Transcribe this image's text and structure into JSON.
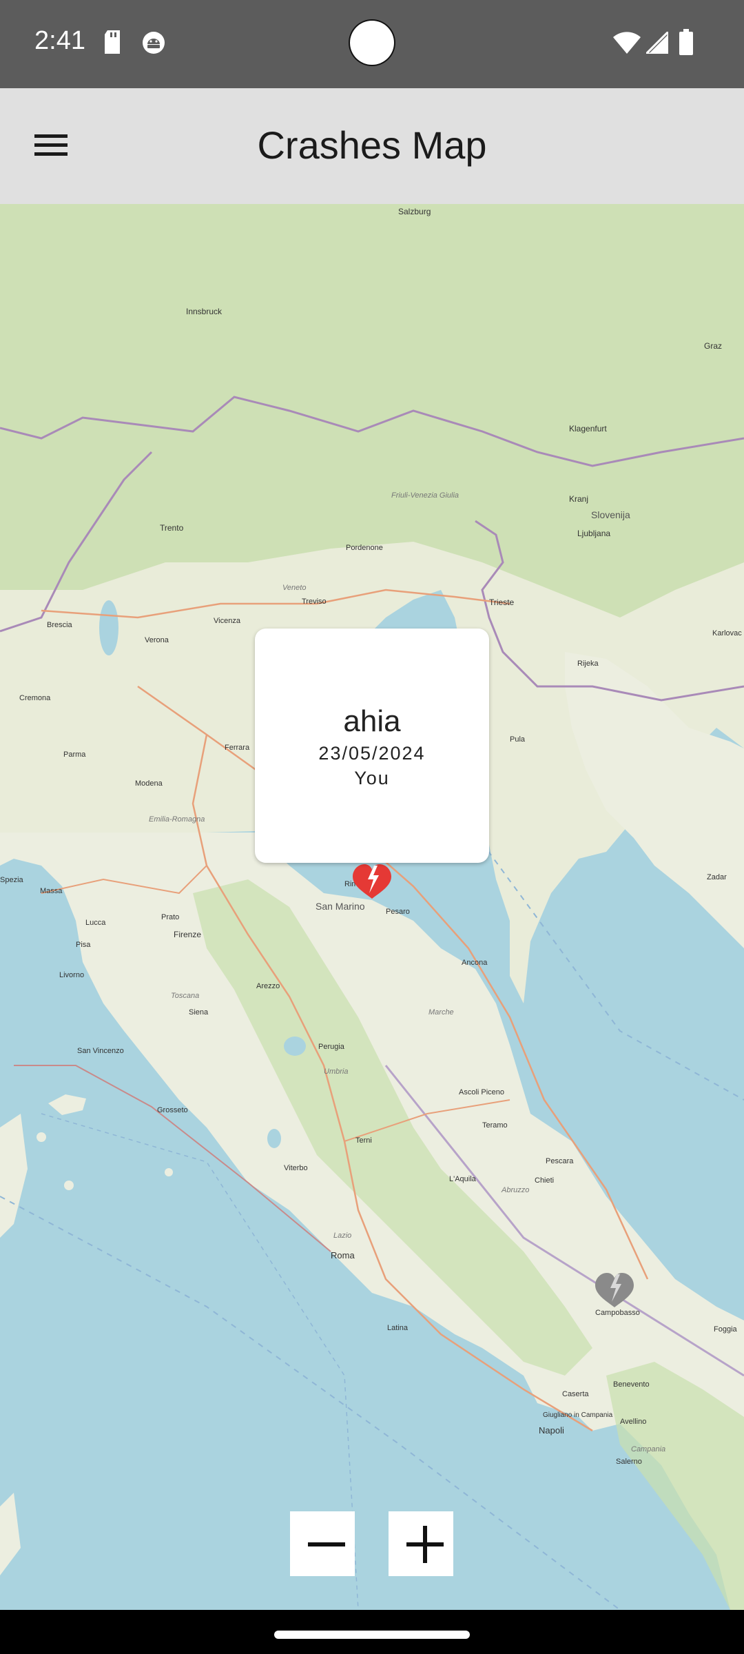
{
  "status_bar": {
    "time": "2:41",
    "left_icons": [
      "sd-card-icon",
      "android-debug-icon"
    ],
    "right_icons": [
      "wifi-icon",
      "cell-signal-icon",
      "battery-icon"
    ]
  },
  "app_bar": {
    "title": "Crashes Map",
    "menu_icon": "hamburger-menu-icon"
  },
  "map": {
    "labels": {
      "salzburg": "Salzburg",
      "innsbruck": "Innsbruck",
      "graz": "Graz",
      "klagenfurt": "Klagenfurt",
      "kranj": "Kranj",
      "slovenija": "Slovenija",
      "ljubljana": "Ljubljana",
      "trento": "Trento",
      "pordenone": "Pordenone",
      "friuli": "Friuli-Venezia Giulia",
      "veneto": "Veneto",
      "treviso": "Treviso",
      "vicenza": "Vicenza",
      "trieste": "Trieste",
      "rijeka": "Rijeka",
      "karlovac": "Karlovac",
      "brescia": "Brescia",
      "verona": "Verona",
      "cremona": "Cremona",
      "parma": "Parma",
      "modena": "Modena",
      "ferrara": "Ferrara",
      "pula": "Pula",
      "emilia": "Emilia-Romagna",
      "spezia": "Spezia",
      "massa": "Massa",
      "lucca": "Lucca",
      "prato": "Prato",
      "firenze": "Firenze",
      "pisa": "Pisa",
      "livorno": "Livorno",
      "toscana": "Toscana",
      "arezzo": "Arezzo",
      "siena": "Siena",
      "san_marino": "San Marino",
      "rimini": "Rimini",
      "pesaro": "Pesaro",
      "ancona": "Ancona",
      "marche": "Marche",
      "zadar": "Zadar",
      "perugia": "Perugia",
      "umbria": "Umbria",
      "ascoli": "Ascoli Piceno",
      "teramo": "Teramo",
      "pescara": "Pescara",
      "chieti": "Chieti",
      "laquila": "L'Aquila",
      "abruzzo": "Abruzzo",
      "terni": "Terni",
      "viterbo": "Viterbo",
      "grosseto": "Grosseto",
      "san_vincenzo": "San Vincenzo",
      "roma": "Roma",
      "lazio": "Lazio",
      "latina": "Latina",
      "campobasso": "Campobasso",
      "foggia": "Foggia",
      "benevento": "Benevento",
      "caserta": "Caserta",
      "avellino": "Avellino",
      "napoli": "Napoli",
      "giugliano": "Giugliano in Campania",
      "campania": "Campania",
      "salerno": "Salerno"
    },
    "markers": [
      {
        "name": "crash-marker-selected",
        "icon": "broken-heart-icon",
        "color": "#e53935"
      },
      {
        "name": "crash-marker-other",
        "icon": "broken-heart-icon",
        "color": "#8a8a8a"
      }
    ],
    "popup": {
      "title": "ahia",
      "date": "23/05/2024",
      "user": "You"
    },
    "zoom_out_icon": "minus-icon",
    "zoom_in_icon": "plus-icon"
  },
  "colors": {
    "status_bar": "#5c5c5c",
    "app_bar": "#e0e0e0",
    "sea": "#aad3df",
    "land": "#f2efe9",
    "forest": "#add19e",
    "marker_selected": "#e53935",
    "marker_other": "#8a8a8a"
  }
}
